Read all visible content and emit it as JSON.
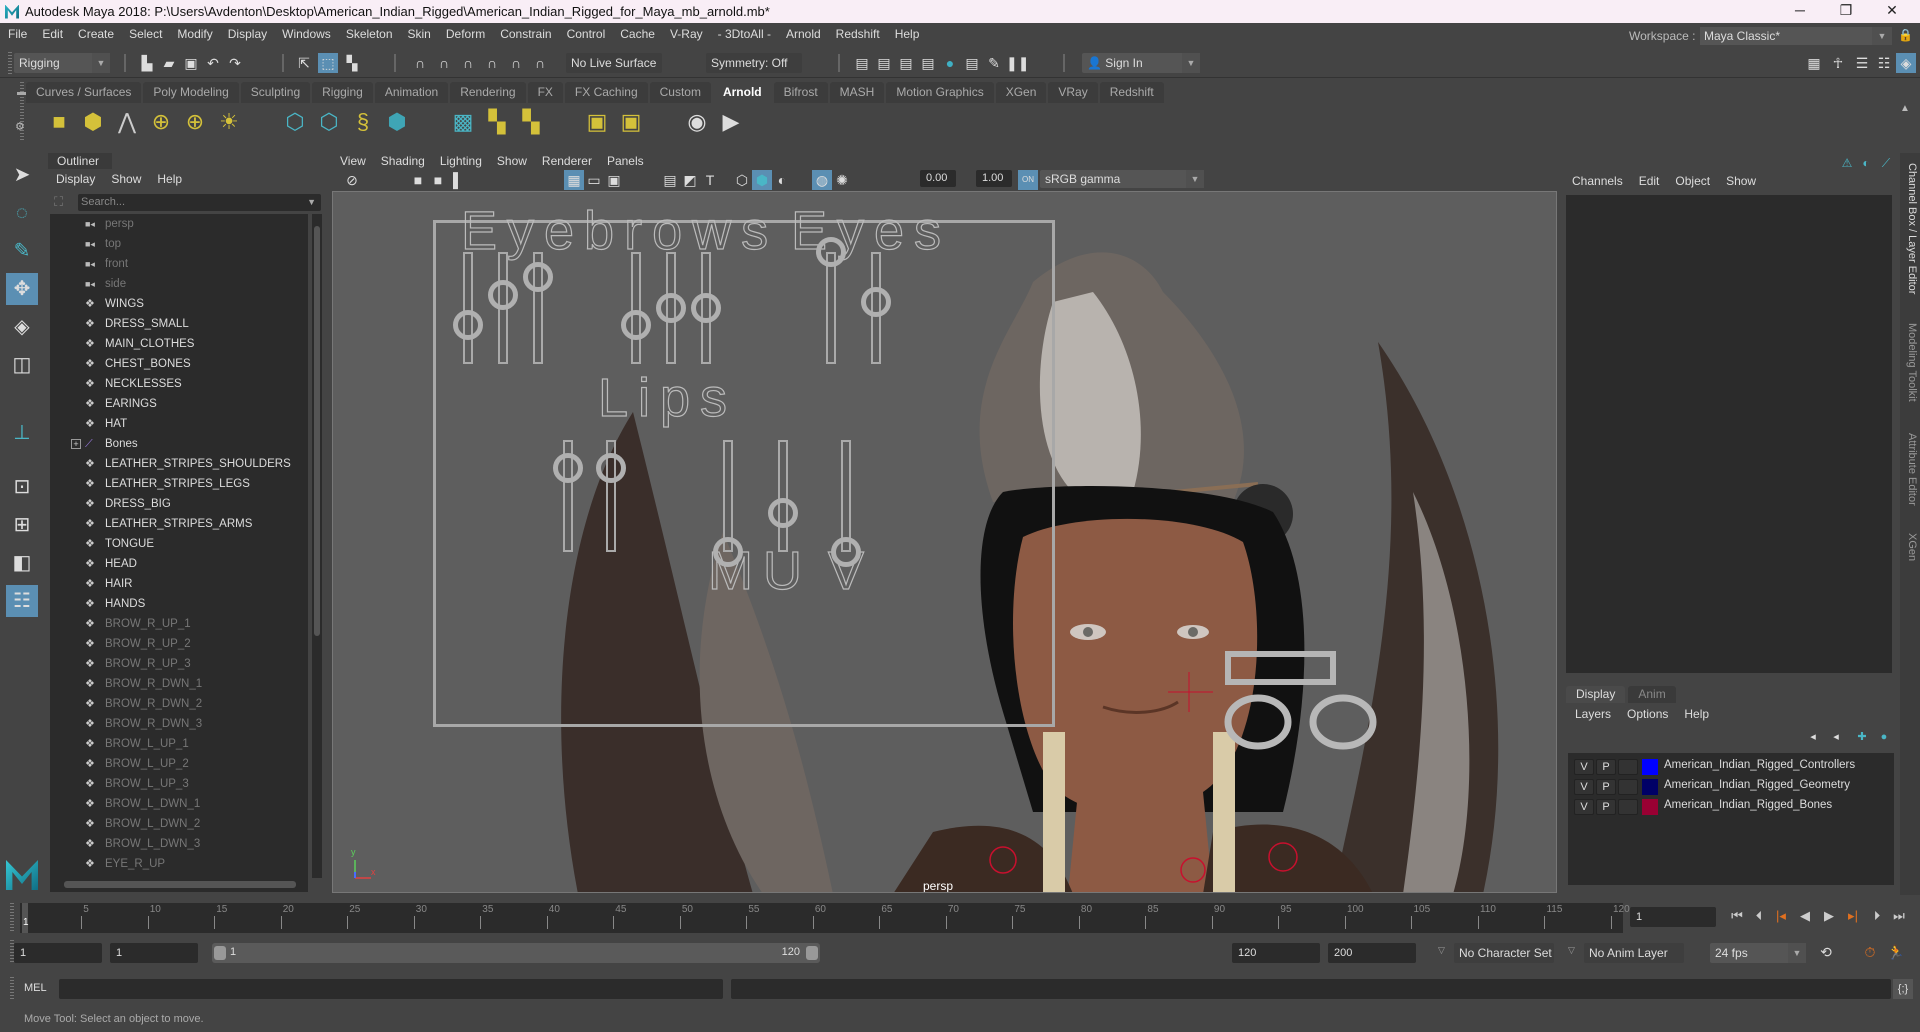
{
  "window": {
    "title": "Autodesk Maya 2018: P:\\Users\\Avdenton\\Desktop\\American_Indian_Rigged\\American_Indian_Rigged_for_Maya_mb_arnold.mb*",
    "controls": {
      "minimize": "─",
      "maximize": "❐",
      "close": "✕"
    }
  },
  "menubar": [
    "File",
    "Edit",
    "Create",
    "Select",
    "Modify",
    "Display",
    "Windows",
    "Skeleton",
    "Skin",
    "Deform",
    "Constrain",
    "Control",
    "Cache",
    "V-Ray",
    "- 3DtoAll -",
    "Arnold",
    "Redshift",
    "Help"
  ],
  "workspace": {
    "label": "Workspace :",
    "value": "Maya Classic*"
  },
  "statusline": {
    "menuset": "Rigging",
    "live_surface": "No Live Surface",
    "symmetry": "Symmetry: Off",
    "sign_in": "Sign In"
  },
  "shelf": {
    "tabs": [
      "Curves / Surfaces",
      "Poly Modeling",
      "Sculpting",
      "Rigging",
      "Animation",
      "Rendering",
      "FX",
      "FX Caching",
      "Custom",
      "Arnold",
      "Bifrost",
      "MASH",
      "Motion Graphics",
      "XGen",
      "VRay",
      "Redshift"
    ],
    "active_tab": "Arnold",
    "icons": [
      "area-light-icon",
      "mesh-light-icon",
      "photometric-light-icon",
      "skydome-light-icon",
      "light-portal-icon",
      "physical-sky-icon",
      "standin-icon",
      "export-standin-icon",
      "curve-collector-icon",
      "volume-icon",
      "render-view-icon",
      "tx-manager-icon",
      "flush-cache-icon",
      "shader-ball-icon",
      "checker-icon",
      "render-window-icon",
      "play-render-icon"
    ]
  },
  "outliner": {
    "tab": "Outliner",
    "menu": [
      "Display",
      "Show",
      "Help"
    ],
    "search_placeholder": "Search...",
    "items": [
      {
        "label": "persp",
        "type": "camera",
        "dim": true
      },
      {
        "label": "top",
        "type": "camera",
        "dim": true
      },
      {
        "label": "front",
        "type": "camera",
        "dim": true
      },
      {
        "label": "side",
        "type": "camera",
        "dim": true
      },
      {
        "label": "WINGS",
        "type": "group",
        "dim": false
      },
      {
        "label": "DRESS_SMALL",
        "type": "group",
        "dim": false
      },
      {
        "label": "MAIN_CLOTHES",
        "type": "group",
        "dim": false
      },
      {
        "label": "CHEST_BONES",
        "type": "group",
        "dim": false
      },
      {
        "label": "NECKLESSES",
        "type": "group",
        "dim": false
      },
      {
        "label": "EARINGS",
        "type": "group",
        "dim": false
      },
      {
        "label": "HAT",
        "type": "group",
        "dim": false
      },
      {
        "label": "Bones",
        "type": "joint",
        "dim": false,
        "expandable": true
      },
      {
        "label": "LEATHER_STRIPES_SHOULDERS",
        "type": "group",
        "dim": false
      },
      {
        "label": "LEATHER_STRIPES_LEGS",
        "type": "group",
        "dim": false
      },
      {
        "label": "DRESS_BIG",
        "type": "group",
        "dim": false
      },
      {
        "label": "LEATHER_STRIPES_ARMS",
        "type": "group",
        "dim": false
      },
      {
        "label": "TONGUE",
        "type": "group",
        "dim": false
      },
      {
        "label": "HEAD",
        "type": "group",
        "dim": false
      },
      {
        "label": "HAIR",
        "type": "group",
        "dim": false
      },
      {
        "label": "HANDS",
        "type": "group",
        "dim": false
      },
      {
        "label": "BROW_R_UP_1",
        "type": "group",
        "dim": true
      },
      {
        "label": "BROW_R_UP_2",
        "type": "group",
        "dim": true
      },
      {
        "label": "BROW_R_UP_3",
        "type": "group",
        "dim": true
      },
      {
        "label": "BROW_R_DWN_1",
        "type": "group",
        "dim": true
      },
      {
        "label": "BROW_R_DWN_2",
        "type": "group",
        "dim": true
      },
      {
        "label": "BROW_R_DWN_3",
        "type": "group",
        "dim": true
      },
      {
        "label": "BROW_L_UP_1",
        "type": "group",
        "dim": true
      },
      {
        "label": "BROW_L_UP_2",
        "type": "group",
        "dim": true
      },
      {
        "label": "BROW_L_UP_3",
        "type": "group",
        "dim": true
      },
      {
        "label": "BROW_L_DWN_1",
        "type": "group",
        "dim": true
      },
      {
        "label": "BROW_L_DWN_2",
        "type": "group",
        "dim": true
      },
      {
        "label": "BROW_L_DWN_3",
        "type": "group",
        "dim": true
      },
      {
        "label": "EYE_R_UP",
        "type": "group",
        "dim": true
      }
    ]
  },
  "viewport": {
    "menu": [
      "View",
      "Shading",
      "Lighting",
      "Show",
      "Renderer",
      "Panels"
    ],
    "exposure": "0.00",
    "gamma": "1.00",
    "color_mgmt_toggle": "ON",
    "view_transform": "sRGB gamma",
    "camera_label": "persp",
    "axis": {
      "y": "y",
      "x": "x",
      "z": "z"
    },
    "face_controls": {
      "labels": [
        "Eyebrows",
        "Eyes",
        "Lips",
        "M",
        "U",
        "V"
      ],
      "eyebrow_sliders": [
        0.35,
        0.62,
        0.78,
        0.35,
        0.5,
        0.5
      ],
      "eye_sliders": [
        1.0,
        0.55
      ],
      "lip_sliders": [
        0.75,
        0.75
      ],
      "muv_sliders": [
        0.0,
        0.35,
        0.0
      ]
    }
  },
  "channel_box": {
    "menu": [
      "Channels",
      "Edit",
      "Object",
      "Show"
    ]
  },
  "layer_editor": {
    "tabs": [
      "Display",
      "Anim"
    ],
    "active_tab": "Display",
    "menu": [
      "Layers",
      "Options",
      "Help"
    ],
    "layers": [
      {
        "v": "V",
        "p": "P",
        "color": "#0000ff",
        "name": "American_Indian_Rigged_Controllers"
      },
      {
        "v": "V",
        "p": "P",
        "color": "#000066",
        "name": "American_Indian_Rigged_Geometry"
      },
      {
        "v": "V",
        "p": "P",
        "color": "#990033",
        "name": "American_Indian_Rigged_Bones"
      }
    ]
  },
  "side_tabs": [
    "Channel Box / Layer Editor",
    "Modeling Toolkit",
    "Attribute Editor",
    "XGen"
  ],
  "timeline": {
    "start": 1,
    "end": 120,
    "current_frame_field": "1",
    "current_frame_marker": "1",
    "tick_labels": [
      5,
      10,
      15,
      20,
      25,
      30,
      35,
      40,
      45,
      50,
      55,
      60,
      65,
      70,
      75,
      80,
      85,
      90,
      95,
      100,
      105,
      110,
      115,
      120
    ]
  },
  "range": {
    "start_time": "1",
    "playback_start": "1",
    "slider_start": "1",
    "slider_end": "120",
    "playback_end": "120",
    "end_time": "200",
    "character_set": "No Character Set",
    "anim_layer": "No Anim Layer",
    "fps": "24 fps"
  },
  "command": {
    "label": "MEL"
  },
  "help_line": "Move Tool: Select an object to move.",
  "colors": {
    "accent": "#5b8fb3",
    "bones": "#c8102e",
    "playhead": "#e07020"
  }
}
